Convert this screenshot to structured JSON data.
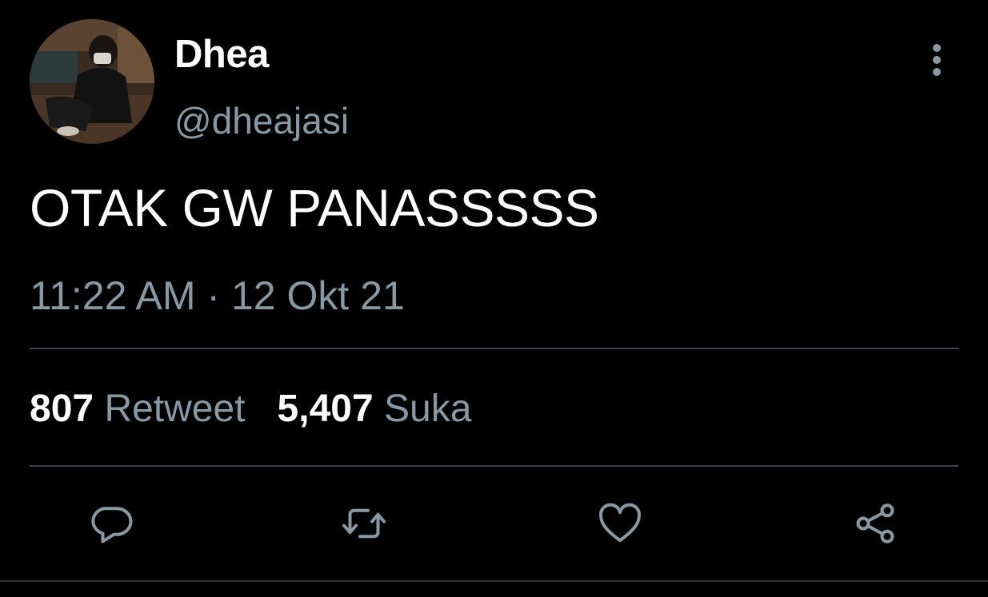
{
  "tweet": {
    "author": {
      "display_name": "Dhea",
      "handle": "@dheajasi"
    },
    "text": "OTAK GW PANASSSSS",
    "timestamp": "11:22 AM · 12 Okt 21",
    "stats": {
      "retweets_count": "807",
      "retweets_label": "Retweet",
      "likes_count": "5,407",
      "likes_label": "Suka"
    }
  },
  "actions": {
    "reply_icon": "comment-icon",
    "retweet_icon": "retweet-icon",
    "like_icon": "heart-icon",
    "share_icon": "share-icon"
  },
  "colors": {
    "background": "#000000",
    "primary_text": "#ffffff",
    "secondary_text": "#8899a6",
    "divider": "#38444d"
  }
}
